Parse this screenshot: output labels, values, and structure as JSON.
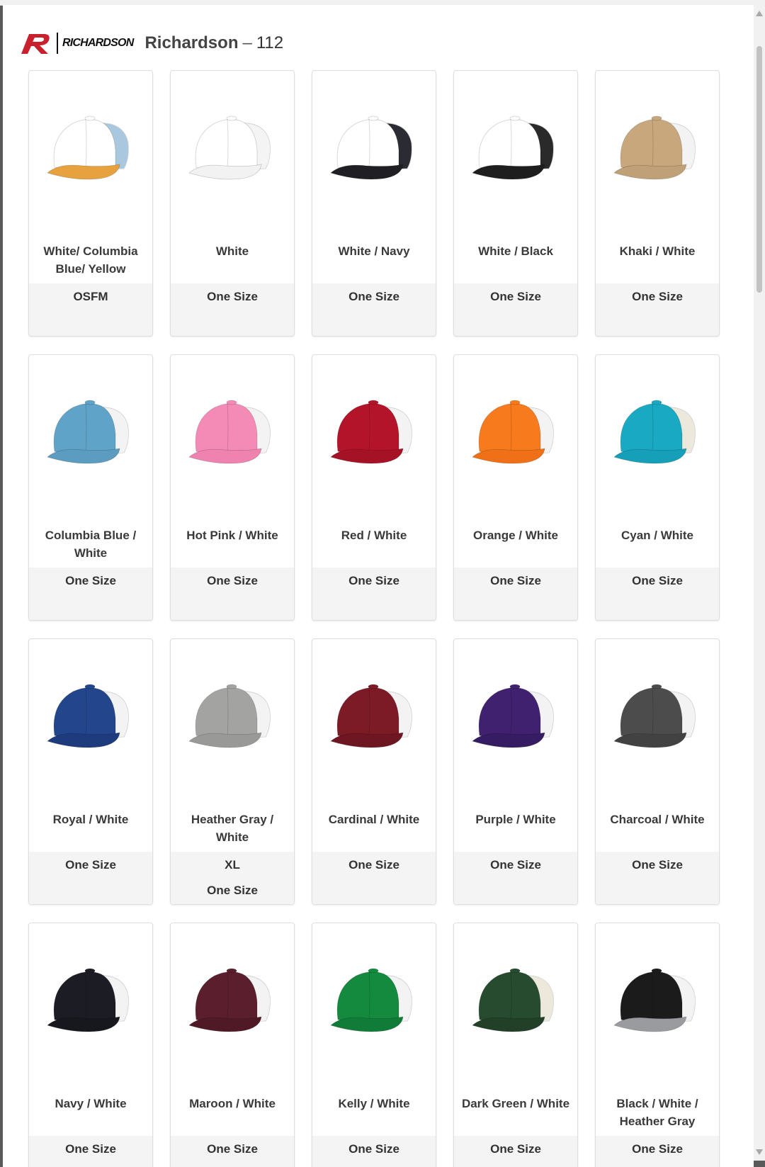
{
  "header": {
    "logo_text": "RICHARDSON",
    "brand": "Richardson",
    "separator": "–",
    "style_number": "112"
  },
  "colors": {
    "brand_red": "#c8202d",
    "card_border": "#dedede",
    "size_bg": "#f4f4f4"
  },
  "products": [
    {
      "name": "White/ Columbia Blue/ Yellow",
      "sizes": [
        "OSFM"
      ],
      "crown": "#ffffff",
      "mesh": "#a9c8df",
      "bill": "#e8a13f"
    },
    {
      "name": "White",
      "sizes": [
        "One Size"
      ],
      "crown": "#ffffff",
      "mesh": "#f4f4f4",
      "bill": "#f2f2f2"
    },
    {
      "name": "White / Navy",
      "sizes": [
        "One Size"
      ],
      "crown": "#ffffff",
      "mesh": "#2b2b33",
      "bill": "#1f1f24"
    },
    {
      "name": "White / Black",
      "sizes": [
        "One Size"
      ],
      "crown": "#ffffff",
      "mesh": "#2a2a2a",
      "bill": "#1e1e1e"
    },
    {
      "name": "Khaki / White",
      "sizes": [
        "One Size"
      ],
      "crown": "#c8a77c",
      "mesh": "#f3f3f3",
      "bill": "#bfa077"
    },
    {
      "name": "Columbia Blue / White",
      "sizes": [
        "One Size"
      ],
      "crown": "#5fa3c8",
      "mesh": "#f3f3f3",
      "bill": "#5b9cc0"
    },
    {
      "name": "Hot Pink / White",
      "sizes": [
        "One Size"
      ],
      "crown": "#f48bb7",
      "mesh": "#f3f3f3",
      "bill": "#ef82ae"
    },
    {
      "name": "Red / White",
      "sizes": [
        "One Size"
      ],
      "crown": "#b3142a",
      "mesh": "#f3f3f3",
      "bill": "#a51226"
    },
    {
      "name": "Orange / White",
      "sizes": [
        "One Size"
      ],
      "crown": "#f77a1c",
      "mesh": "#f3f3f3",
      "bill": "#f07018"
    },
    {
      "name": "Cyan / White",
      "sizes": [
        "One Size"
      ],
      "crown": "#1aa9c2",
      "mesh": "#ece9dc",
      "bill": "#169fb8"
    },
    {
      "name": "Royal / White",
      "sizes": [
        "One Size"
      ],
      "crown": "#23458c",
      "mesh": "#f3f3f3",
      "bill": "#1e3c7d"
    },
    {
      "name": "Heather Gray / White",
      "sizes": [
        "XL",
        "One Size"
      ],
      "crown": "#a3a4a2",
      "mesh": "#f3f3f3",
      "bill": "#999a98"
    },
    {
      "name": "Cardinal / White",
      "sizes": [
        "One Size"
      ],
      "crown": "#7c1a26",
      "mesh": "#f3f3f3",
      "bill": "#6e1621"
    },
    {
      "name": "Purple / White",
      "sizes": [
        "One Size"
      ],
      "crown": "#3f2170",
      "mesh": "#f3f3f3",
      "bill": "#361c62"
    },
    {
      "name": "Charcoal / White",
      "sizes": [
        "One Size"
      ],
      "crown": "#4c4c4c",
      "mesh": "#f3f3f3",
      "bill": "#424242"
    },
    {
      "name": "Navy / White",
      "sizes": [
        "One Size"
      ],
      "crown": "#1c1d24",
      "mesh": "#f3f3f3",
      "bill": "#17181e"
    },
    {
      "name": "Maroon / White",
      "sizes": [
        "One Size"
      ],
      "crown": "#5a1e2c",
      "mesh": "#f3f3f3",
      "bill": "#4f1a26"
    },
    {
      "name": "Kelly / White",
      "sizes": [
        "One Size"
      ],
      "crown": "#138a3e",
      "mesh": "#f3f3f3",
      "bill": "#117c37"
    },
    {
      "name": "Dark Green / White",
      "sizes": [
        "One Size"
      ],
      "crown": "#274b2e",
      "mesh": "#ece9dc",
      "bill": "#214027"
    },
    {
      "name": "Black / White / Heather Gray",
      "sizes": [
        "One Size"
      ],
      "crown": "#1b1b1b",
      "mesh": "#f3f3f3",
      "bill": "#9a9b9e"
    }
  ]
}
